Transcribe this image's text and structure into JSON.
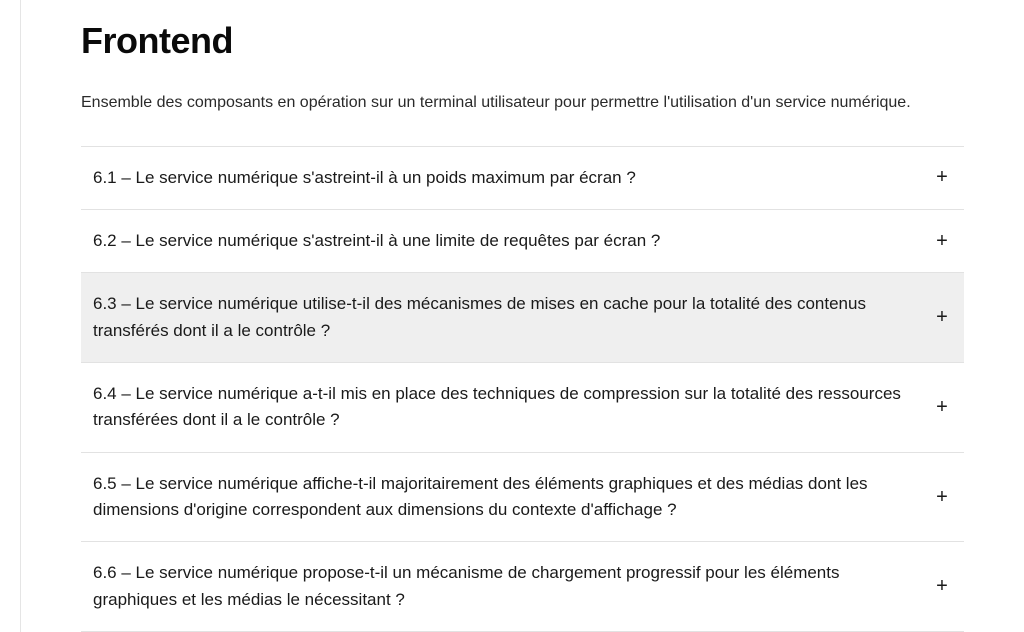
{
  "title": "Frontend",
  "description": "Ensemble des composants en opération sur un terminal utilisateur pour permettre l'utilisation d'un service numérique.",
  "items": [
    {
      "label": "6.1 – Le service numérique s'astreint-il à un poids maximum par écran ?",
      "hovered": false
    },
    {
      "label": "6.2 – Le service numérique s'astreint-il à une limite de requêtes par écran ?",
      "hovered": false
    },
    {
      "label": "6.3 – Le service numérique utilise-t-il des mécanismes de mises en cache pour la totalité des contenus transférés dont il a le contrôle ?",
      "hovered": true
    },
    {
      "label": "6.4 – Le service numérique a-t-il mis en place des techniques de compression sur la totalité des ressources transférées dont il a le contrôle ?",
      "hovered": false
    },
    {
      "label": "6.5 – Le service numérique affiche-t-il majoritairement des éléments graphiques et des médias dont les dimensions d'origine correspondent aux dimensions du contexte d'affichage ?",
      "hovered": false
    },
    {
      "label": "6.6 – Le service numérique propose-t-il un mécanisme de chargement progressif pour les éléments graphiques et les médias le nécessitant ?",
      "hovered": false
    }
  ],
  "expand_symbol": "+"
}
